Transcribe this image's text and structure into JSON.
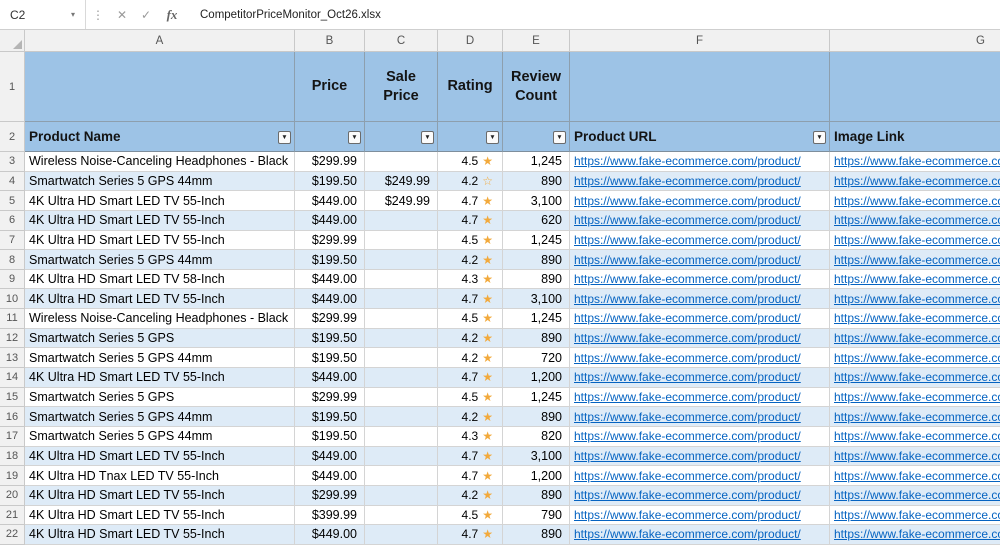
{
  "toolbar": {
    "cell_reference": "C2",
    "fx_label": "fx",
    "formula_text": "CompetitorPriceMonitor_Oct26.xlsx"
  },
  "columns": [
    "A",
    "B",
    "C",
    "D",
    "E",
    "F",
    "G"
  ],
  "gutter": {
    "r1": "1",
    "r2": "2"
  },
  "headers": {
    "price": "Price",
    "sale_price": "Sale Price",
    "rating": "Rating",
    "review_count": "Review Count",
    "product_name": "Product Name",
    "product_url": "Product URL",
    "image_link": "Image Link"
  },
  "links": {
    "product_url": "https://www.fake-ecommerce.com/product/",
    "image_link": "https://www.fake-ecommerce.com/"
  },
  "colors": {
    "header_blue": "#9DC3E6",
    "band_blue": "#DEEBF7",
    "link_blue": "#0563C1",
    "star_gold": "#F2A93B"
  },
  "rows": [
    {
      "num": 3,
      "product": "Wireless Noise-Canceling Headphones - Black",
      "price": "$299.99",
      "sale": "",
      "rating": "4.5",
      "star": "filled",
      "reviews": "1,245"
    },
    {
      "num": 4,
      "product": "Smartwatch Series 5 GPS 44mm",
      "price": "$199.50",
      "sale": "$249.99",
      "rating": "4.2",
      "star": "outline",
      "reviews": "890"
    },
    {
      "num": 5,
      "product": "4K Ultra HD Smart LED TV 55-Inch",
      "price": "$449.00",
      "sale": "$249.99",
      "rating": "4.7",
      "star": "filled",
      "reviews": "3,100"
    },
    {
      "num": 6,
      "product": "4K Ultra HD Smart LED TV 55-Inch",
      "price": "$449.00",
      "sale": "",
      "rating": "4.7",
      "star": "filled",
      "reviews": "620"
    },
    {
      "num": 7,
      "product": "4K Ultra HD Smart LED TV 55-Inch",
      "price": "$299.99",
      "sale": "",
      "rating": "4.5",
      "star": "filled",
      "reviews": "1,245"
    },
    {
      "num": 8,
      "product": "Smartwatch Series 5 GPS 44mm",
      "price": "$199.50",
      "sale": "",
      "rating": "4.2",
      "star": "filled",
      "reviews": "890"
    },
    {
      "num": 9,
      "product": "4K Ultra HD Smart LED TV 58-Inch",
      "price": "$449.00",
      "sale": "",
      "rating": "4.3",
      "star": "filled",
      "reviews": "890"
    },
    {
      "num": 10,
      "product": "4K Ultra HD Smart LED TV 55-Inch",
      "price": "$449.00",
      "sale": "",
      "rating": "4.7",
      "star": "filled",
      "reviews": "3,100"
    },
    {
      "num": 11,
      "product": "Wireless Noise-Canceling Headphones - Black",
      "price": "$299.99",
      "sale": "",
      "rating": "4.5",
      "star": "filled",
      "reviews": "1,245"
    },
    {
      "num": 12,
      "product": "Smartwatch Series 5 GPS",
      "price": "$199.50",
      "sale": "",
      "rating": "4.2",
      "star": "filled",
      "reviews": "890"
    },
    {
      "num": 13,
      "product": "Smartwatch Series 5 GPS 44mm",
      "price": "$199.50",
      "sale": "",
      "rating": "4.2",
      "star": "filled",
      "reviews": "720"
    },
    {
      "num": 14,
      "product": "4K Ultra HD Smart LED TV 55-Inch",
      "price": "$449.00",
      "sale": "",
      "rating": "4.7",
      "star": "filled",
      "reviews": "1,200"
    },
    {
      "num": 15,
      "product": "Smartwatch Series 5 GPS",
      "price": "$299.99",
      "sale": "",
      "rating": "4.5",
      "star": "filled",
      "reviews": "1,245"
    },
    {
      "num": 16,
      "product": "Smartwatch Series 5 GPS 44mm",
      "price": "$199.50",
      "sale": "",
      "rating": "4.2",
      "star": "filled",
      "reviews": "890"
    },
    {
      "num": 17,
      "product": "Smartwatch Series 5 GPS 44mm",
      "price": "$199.50",
      "sale": "",
      "rating": "4.3",
      "star": "filled",
      "reviews": "820"
    },
    {
      "num": 18,
      "product": "4K Ultra HD Smart LED TV 55-Inch",
      "price": "$449.00",
      "sale": "",
      "rating": "4.7",
      "star": "filled",
      "reviews": "3,100"
    },
    {
      "num": 19,
      "product": "4K Ultra HD Tnax LED TV 55-Inch",
      "price": "$449.00",
      "sale": "",
      "rating": "4.7",
      "star": "filled",
      "reviews": "1,200"
    },
    {
      "num": 20,
      "product": "4K Ultra HD Smart LED TV 55-Inch",
      "price": "$299.99",
      "sale": "",
      "rating": "4.2",
      "star": "filled",
      "reviews": "890"
    },
    {
      "num": 21,
      "product": "4K Ultra HD Smart LED TV 55-Inch",
      "price": "$399.99",
      "sale": "",
      "rating": "4.5",
      "star": "filled",
      "reviews": "790"
    },
    {
      "num": 22,
      "product": "4K Ultra HD Smart LED TV 55-Inch",
      "price": "$449.00",
      "sale": "",
      "rating": "4.7",
      "star": "filled",
      "reviews": "890"
    }
  ]
}
